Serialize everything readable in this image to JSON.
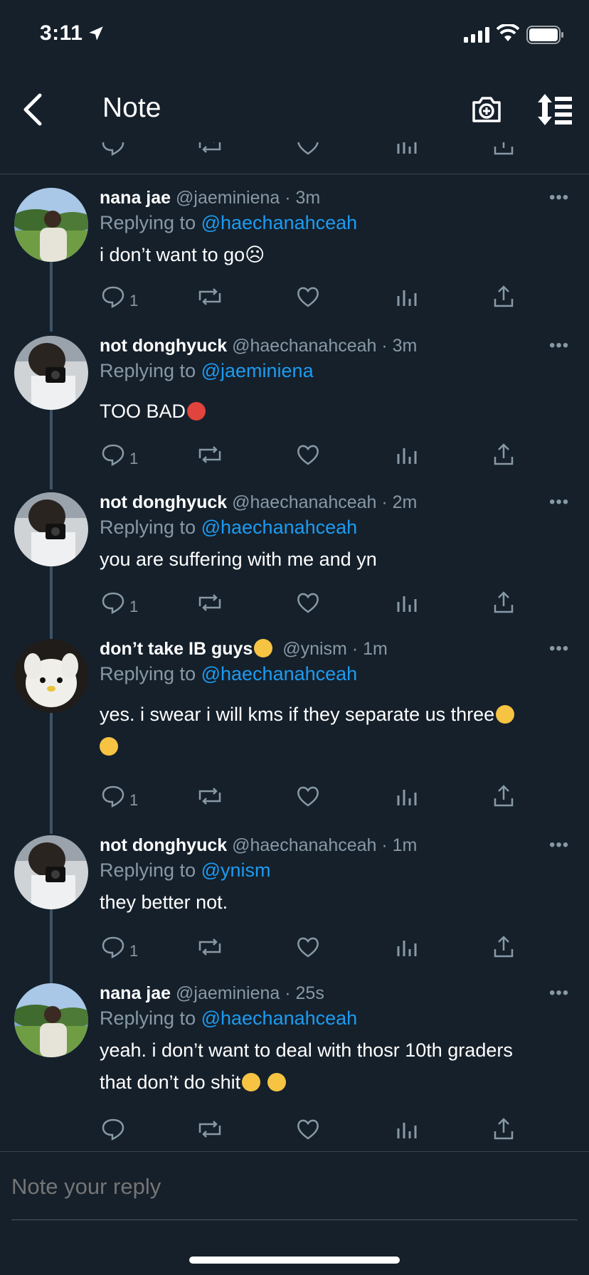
{
  "status": {
    "time": "3:11"
  },
  "header": {
    "title": "Note"
  },
  "tweets": [
    {
      "name": "nana jae",
      "handle": "@jaeminiena · 3m",
      "replying_prefix": "Replying to ",
      "replying_to": "@haechanahceah",
      "text": "i don’t want to go☹",
      "reply_count": "1",
      "more": "•••"
    },
    {
      "name": "not donghyuck",
      "handle": "@haechanahceah · 3m",
      "replying_prefix": "Replying to ",
      "replying_to": "@jaeminiena",
      "text": "TOO BAD",
      "reply_count": "1",
      "more": "•••"
    },
    {
      "name": "not donghyuck",
      "handle": "@haechanahceah · 2m",
      "replying_prefix": "Replying to ",
      "replying_to": "@haechanahceah",
      "text": "you are suffering with me and yn",
      "reply_count": "1",
      "more": "•••"
    },
    {
      "name": "don’t take IB guys",
      "handle": "@ynism · 1m",
      "replying_prefix": "Replying to ",
      "replying_to": "@haechanahceah",
      "text": "yes. i swear i will kms if they separate us three",
      "reply_count": "1",
      "more": "•••"
    },
    {
      "name": "not donghyuck",
      "handle": "@haechanahceah · 1m",
      "replying_prefix": "Replying to ",
      "replying_to": "@ynism",
      "text": "they better not.",
      "reply_count": "1",
      "more": "•••"
    },
    {
      "name": "nana jae",
      "handle": "@jaeminiena · 25s",
      "replying_prefix": "Replying to ",
      "replying_to": "@haechanahceah",
      "text_line1": "yeah. i don’t want to deal with thosr 10th graders",
      "text_line2": "that don’t do shit",
      "reply_count": "",
      "more": "•••"
    }
  ],
  "reply": {
    "placeholder": "Note your reply"
  },
  "colors": {
    "background": "#15202b",
    "accent": "#1d9bf0",
    "muted": "#8899a6",
    "divider": "#38444d"
  }
}
